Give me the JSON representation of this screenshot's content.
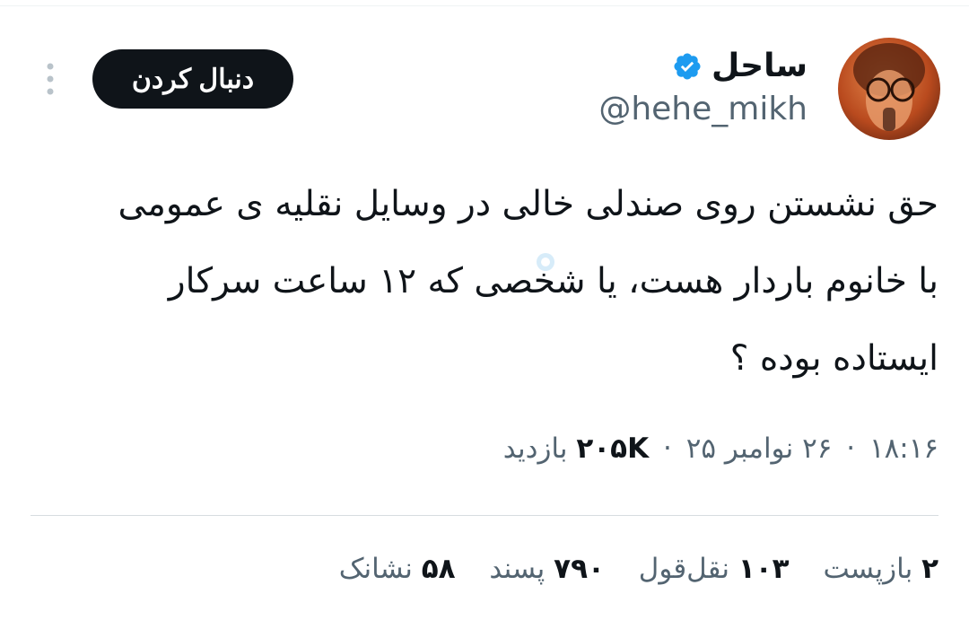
{
  "author": {
    "display_name": "ساحل",
    "handle": "@hehe_mikh",
    "verified": true
  },
  "follow_button": {
    "label": "دنبال کردن"
  },
  "tweet": {
    "lines": [
      "حق نشستن روی صندلی خالی در وسایل نقلیه ی عمومی",
      "با خانوم باردار هست، یا شخصی که ۱۲ ساعت سرکار",
      "ایستاده بوده ؟"
    ]
  },
  "meta": {
    "time": "۱۸:۱۶",
    "date": "۲۶ نوامبر ۲۵",
    "views_count": "۲۰۵K",
    "views_label": "بازدید",
    "separator": "·"
  },
  "stats": {
    "reposts": {
      "value": "۲",
      "label": "بازپست"
    },
    "quotes": {
      "value": "۱۰۳",
      "label": "نقل‌قول"
    },
    "likes": {
      "value": "۷۹۰",
      "label": "پسند"
    },
    "bookmarks": {
      "value": "۵۸",
      "label": "نشانک"
    }
  },
  "colors": {
    "verified_blue": "#1d9bf0",
    "secondary_text": "#536471",
    "primary_text": "#0f1419"
  }
}
